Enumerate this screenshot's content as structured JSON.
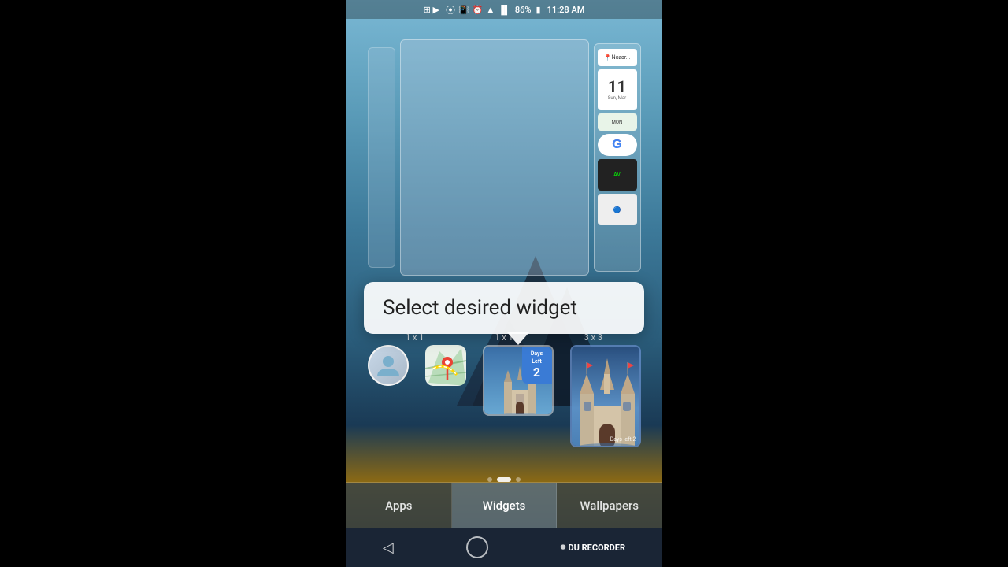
{
  "status_bar": {
    "time": "11:28 AM",
    "battery": "86%",
    "icons": [
      "bluetooth",
      "vibrate",
      "alarm",
      "wifi",
      "signal"
    ]
  },
  "tooltip": {
    "text": "Select desired widget",
    "arrow_direction": "down"
  },
  "widget_sizes": [
    {
      "label": "1 x 1"
    },
    {
      "label": "1 x 1"
    },
    {
      "label": "3 x 3"
    }
  ],
  "widgets": [
    {
      "name": "contacts-widget",
      "type": "contacts",
      "size": "1x1"
    },
    {
      "name": "maps-widget",
      "type": "maps",
      "size": "1x1"
    },
    {
      "name": "disney-1x1",
      "type": "disney-days",
      "size": "1x1",
      "days": "2"
    },
    {
      "name": "disney-3x3",
      "type": "disney-large",
      "size": "3x3",
      "days_left_text": "Days Left 2"
    }
  ],
  "tabs": [
    {
      "label": "Apps",
      "active": false
    },
    {
      "label": "Widgets",
      "active": true
    },
    {
      "label": "Wallpapers",
      "active": false
    }
  ],
  "nav": {
    "back_icon": "◁",
    "home_icon": "○",
    "recorder_label": "DU RECORDER"
  },
  "right_panel": {
    "location": "Nozar...",
    "calendar_date": "11",
    "calendar_day": "Sun, Mar",
    "agenda_label": "MON",
    "google_label": "G"
  },
  "dot_indicator": {
    "total": 3,
    "active_index": 1
  }
}
